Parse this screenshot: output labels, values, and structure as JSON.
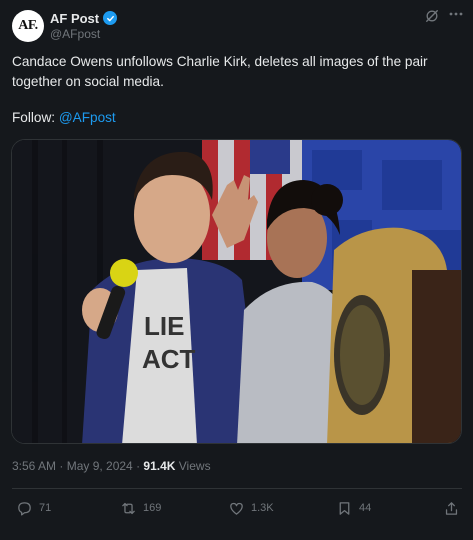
{
  "author": {
    "avatar_text": "AF.",
    "display_name": "AF Post",
    "handle": "@AFpost",
    "verified": true
  },
  "tweet": {
    "text": "Candace Owens unfollows Charlie Kirk, deletes all images of the pair together on social media.",
    "follow_prefix": "Follow: ",
    "follow_link": "@AFpost"
  },
  "meta": {
    "timestamp": "3:56 AM · May 9, 2024 · ",
    "views_count": "91.4K",
    "views_label": " Views"
  },
  "actions": {
    "replies": "71",
    "reposts": "169",
    "likes": "1.3K",
    "bookmarks": "44"
  },
  "colors": {
    "background": "#15181c",
    "accent": "#1d9bf0",
    "muted": "#71767b",
    "text": "#e7e9ea"
  },
  "icons": [
    "verified-badge-icon",
    "grok-icon",
    "more-icon",
    "reply-icon",
    "repost-icon",
    "like-icon",
    "bookmark-icon",
    "share-icon"
  ]
}
